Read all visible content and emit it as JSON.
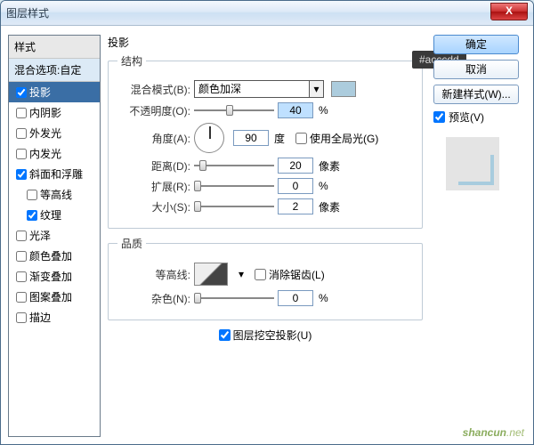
{
  "window": {
    "title": "图层样式"
  },
  "tooltip": {
    "text": "#acccdd"
  },
  "sidebar": {
    "header": "样式",
    "subheader": "混合选项:自定",
    "items": [
      {
        "label": "投影",
        "checked": true,
        "selected": true
      },
      {
        "label": "内阴影",
        "checked": false
      },
      {
        "label": "外发光",
        "checked": false
      },
      {
        "label": "内发光",
        "checked": false
      },
      {
        "label": "斜面和浮雕",
        "checked": true
      },
      {
        "label": "等高线",
        "checked": false,
        "indent": true
      },
      {
        "label": "纹理",
        "checked": true,
        "indent": true
      },
      {
        "label": "光泽",
        "checked": false
      },
      {
        "label": "颜色叠加",
        "checked": false
      },
      {
        "label": "渐变叠加",
        "checked": false
      },
      {
        "label": "图案叠加",
        "checked": false
      },
      {
        "label": "描边",
        "checked": false
      }
    ]
  },
  "main": {
    "title": "投影",
    "structure": {
      "legend": "结构",
      "blend_label": "混合模式(B):",
      "blend_value": "颜色加深",
      "opacity_label": "不透明度(O):",
      "opacity_value": "40",
      "opacity_unit": "%",
      "angle_label": "角度(A):",
      "angle_value": "90",
      "angle_unit": "度",
      "global_light": "使用全局光(G)",
      "distance_label": "距离(D):",
      "distance_value": "20",
      "distance_unit": "像素",
      "spread_label": "扩展(R):",
      "spread_value": "0",
      "spread_unit": "%",
      "size_label": "大小(S):",
      "size_value": "2",
      "size_unit": "像素"
    },
    "quality": {
      "legend": "品质",
      "contour_label": "等高线:",
      "antialias": "消除锯齿(L)",
      "noise_label": "杂色(N):",
      "noise_value": "0",
      "noise_unit": "%"
    },
    "knockout": "图层挖空投影(U)"
  },
  "buttons": {
    "ok": "确定",
    "cancel": "取消",
    "newstyle": "新建样式(W)...",
    "preview": "预览(V)"
  },
  "watermark": {
    "text": "shancun",
    "suffix": ".net"
  }
}
